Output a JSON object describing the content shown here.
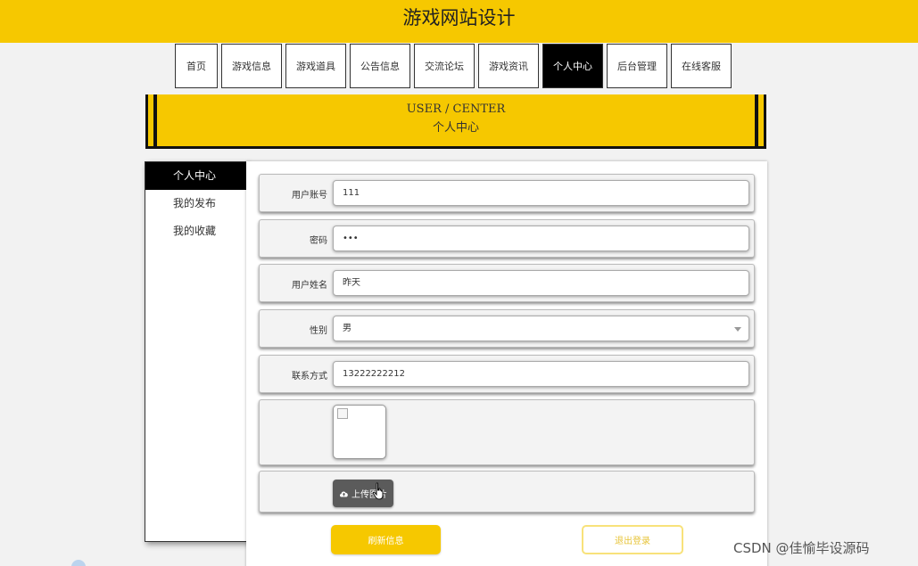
{
  "site": {
    "title": "游戏网站设计"
  },
  "nav": {
    "items": [
      {
        "label": "首页"
      },
      {
        "label": "游戏信息"
      },
      {
        "label": "游戏道具"
      },
      {
        "label": "公告信息"
      },
      {
        "label": "交流论坛"
      },
      {
        "label": "游戏资讯"
      },
      {
        "label": "个人中心"
      },
      {
        "label": "后台管理"
      },
      {
        "label": "在线客服"
      }
    ],
    "active": "个人中心"
  },
  "banner": {
    "title_en": "USER / CENTER",
    "title_cn": "个人中心"
  },
  "sidebar": {
    "items": [
      {
        "label": "个人中心"
      },
      {
        "label": "我的发布"
      },
      {
        "label": "我的收藏"
      }
    ],
    "active": "个人中心"
  },
  "form": {
    "account": {
      "label": "用户账号",
      "value": "111"
    },
    "password": {
      "label": "密码",
      "value": "•••"
    },
    "name": {
      "label": "用户姓名",
      "value": "昨天"
    },
    "gender": {
      "label": "性别",
      "value": "男"
    },
    "contact": {
      "label": "联系方式",
      "value": "13222222212"
    },
    "avatar": {
      "icon": "broken-image-icon"
    },
    "upload": {
      "label": "上传图片",
      "icon": "cloud-upload-icon"
    }
  },
  "actions": {
    "refresh_label": "刷新信息",
    "logout_label": "退出登录"
  },
  "watermark": "CSDN @佳愉毕设源码",
  "colors": {
    "accent": "#f6c800",
    "dark": "#000000",
    "logout_text": "#e7c43a"
  }
}
